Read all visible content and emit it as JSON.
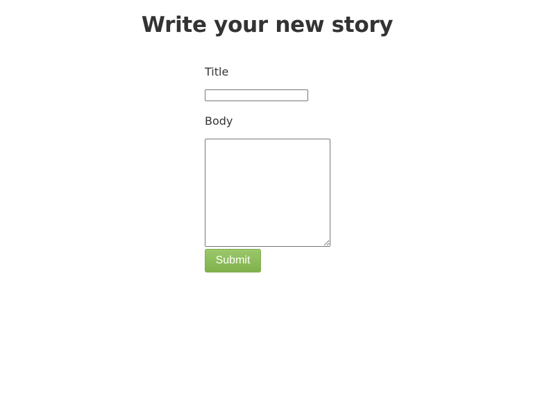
{
  "heading": "Write your new story",
  "form": {
    "title_label": "Title",
    "title_value": "",
    "body_label": "Body",
    "body_value": "",
    "submit_label": "Submit"
  }
}
